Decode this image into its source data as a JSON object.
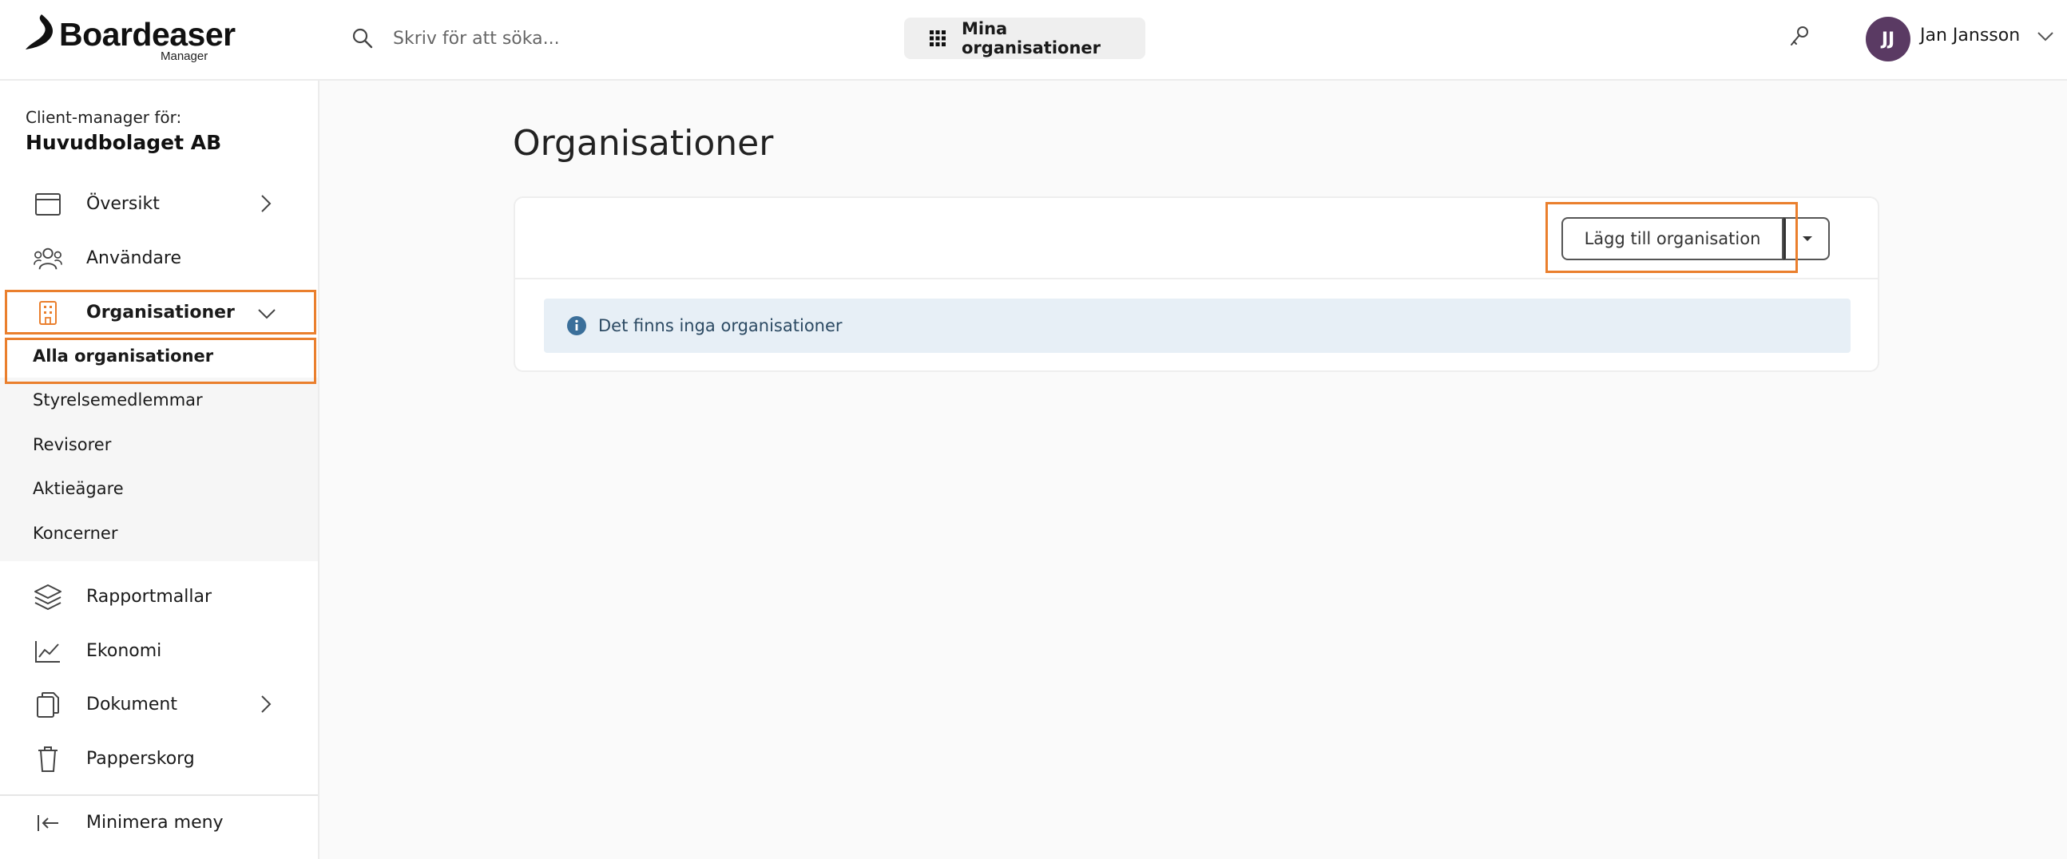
{
  "header": {
    "logo_text": "Boardeaser",
    "logo_subtext": "Manager",
    "search_placeholder": "Skriv för att söka...",
    "my_orgs_label": "Mina organisationer",
    "user_initials": "JJ",
    "user_name": "Jan Jansson",
    "avatar_color": "#5a3a63"
  },
  "sidebar": {
    "client_label": "Client-manager för:",
    "client_name": "Huvudbolaget AB",
    "items": [
      {
        "label": "Översikt",
        "icon": "calendar-window-icon",
        "has_chevron": "right"
      },
      {
        "label": "Användare",
        "icon": "users-icon"
      },
      {
        "label": "Organisationer",
        "icon": "building-icon",
        "has_chevron": "down",
        "expanded": true
      },
      {
        "label": "Rapportmallar",
        "icon": "layers-icon"
      },
      {
        "label": "Ekonomi",
        "icon": "line-chart-icon"
      },
      {
        "label": "Dokument",
        "icon": "documents-icon",
        "has_chevron": "right"
      },
      {
        "label": "Papperskorg",
        "icon": "trash-icon"
      }
    ],
    "subitems": [
      {
        "label": "Alla organisationer",
        "active": true
      },
      {
        "label": "Styrelsemedlemmar"
      },
      {
        "label": "Revisorer"
      },
      {
        "label": "Aktieägare"
      },
      {
        "label": "Koncerner"
      }
    ],
    "minimize_label": "Minimera meny"
  },
  "main": {
    "title": "Organisationer",
    "add_button_label": "Lägg till organisation",
    "empty_message": "Det finns inga organisationer"
  },
  "colors": {
    "accent_highlight": "#ea7f2d",
    "info_background": "#e7eff6",
    "info_icon": "#3b6f9a"
  }
}
